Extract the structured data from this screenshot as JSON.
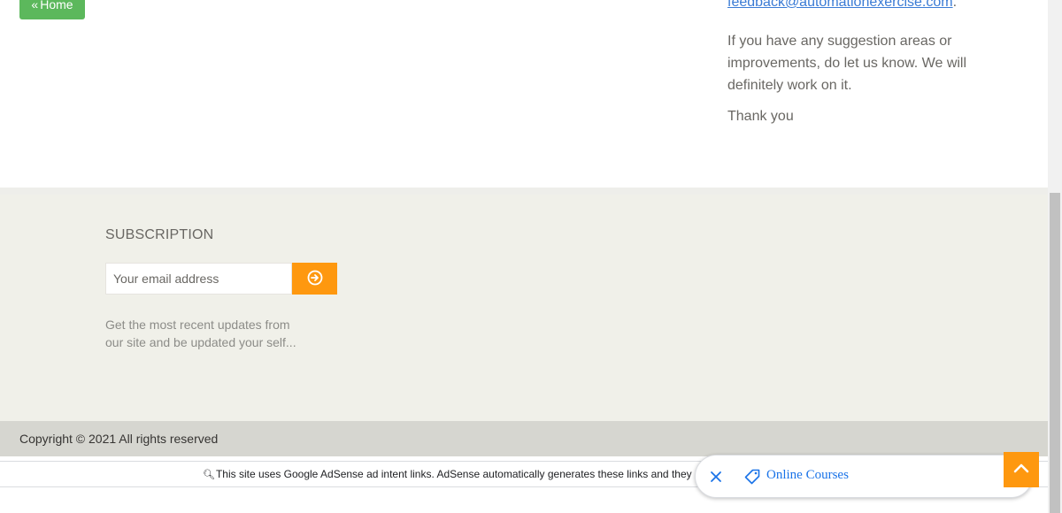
{
  "home_button": {
    "label": "Home",
    "icon": "double-chevron-left-icon"
  },
  "contact": {
    "email_link": "feedback@automationexercise.com",
    "email_suffix": ".",
    "suggestion": "If you have any suggestion areas or improvements, do let us know. We will definitely work on it.",
    "thanks": "Thank you"
  },
  "subscription": {
    "title": "SUBSCRIPTION",
    "email_placeholder": "Your email address",
    "submit_icon": "arrow-circle-right-icon",
    "description": "Get the most recent updates from our site and be updated your self..."
  },
  "footer": {
    "copyright": "Copyright © 2021 All rights reserved"
  },
  "adsense": {
    "notice": "This site uses Google AdSense ad intent links. AdSense automatically generates these links and they"
  },
  "chip": {
    "link_label": "Online Courses"
  },
  "colors": {
    "accent": "#fe980f",
    "home_green": "#5cb85c",
    "footer_bg": "#f0f0e9",
    "link_blue": "#1a73e8"
  }
}
